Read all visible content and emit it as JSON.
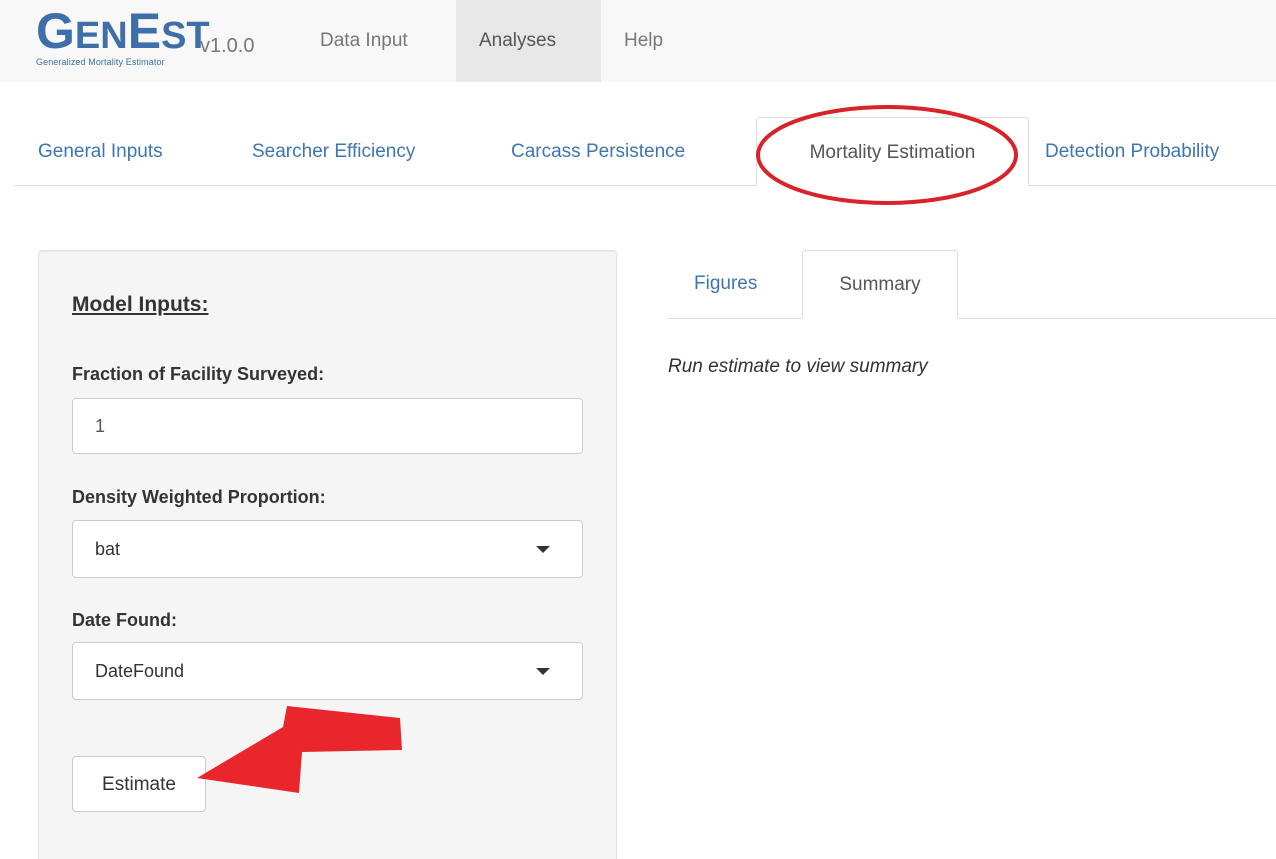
{
  "app": {
    "logo_initial_1": "G",
    "logo_rest_1": "EN",
    "logo_initial_2": "E",
    "logo_rest_2": "ST",
    "logo_tagline": "Generalized Mortality Estimator",
    "version": "v1.0.0"
  },
  "navbar": {
    "items": [
      {
        "label": "Data Input",
        "active": false
      },
      {
        "label": "Analyses",
        "active": true
      },
      {
        "label": "Help",
        "active": false
      }
    ]
  },
  "analysis_tabs": [
    {
      "label": "General Inputs",
      "active": false
    },
    {
      "label": "Searcher Efficiency",
      "active": false
    },
    {
      "label": "Carcass Persistence",
      "active": false
    },
    {
      "label": "Mortality Estimation",
      "active": true
    },
    {
      "label": "Detection Probability",
      "active": false
    }
  ],
  "sidebar": {
    "title": "Model Inputs:",
    "fraction_label": "Fraction of Facility Surveyed:",
    "fraction_value": "1",
    "dwp_label": "Density Weighted Proportion:",
    "dwp_value": "bat",
    "date_label": "Date Found:",
    "date_value": "DateFound",
    "estimate_button": "Estimate"
  },
  "main": {
    "tabs": [
      {
        "label": "Figures",
        "active": false
      },
      {
        "label": "Summary",
        "active": true
      }
    ],
    "summary_message": "Run estimate to view summary"
  },
  "annotations": {
    "highlight_color": "#d9232a",
    "arrow_color": "#e8262b"
  },
  "colors": {
    "brand_blue": "#3e6fa8",
    "link_blue": "#3e76b1"
  }
}
